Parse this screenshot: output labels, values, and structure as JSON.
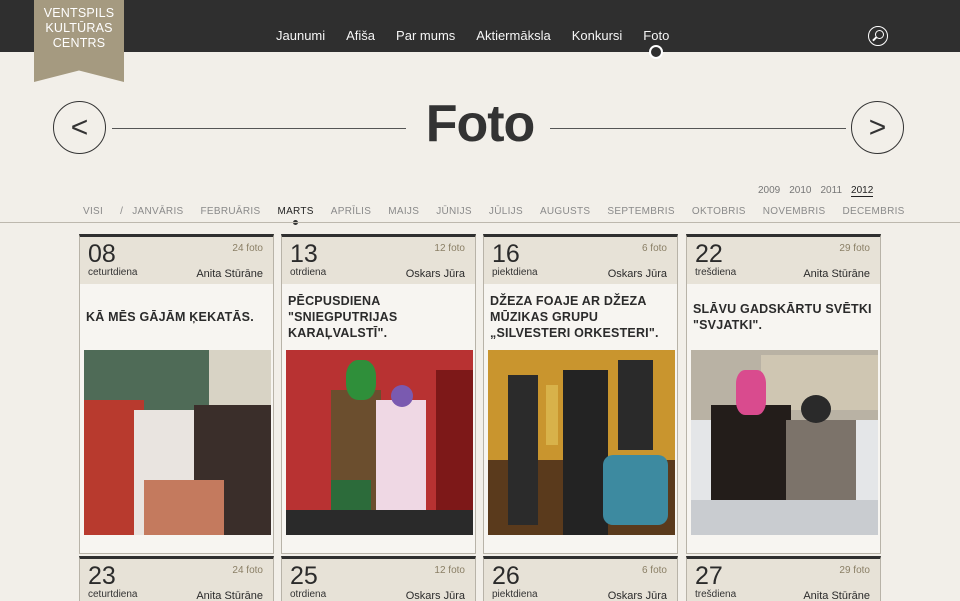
{
  "logo": {
    "line1": "VENTSPILS",
    "line2": "KULTŪRAS",
    "line3": "CENTRS"
  },
  "nav": [
    "Jaunumi",
    "Afiša",
    "Par mums",
    "Aktiermāksla",
    "Konkursi",
    "Foto"
  ],
  "header": {
    "title": "Foto",
    "prev": "<",
    "next": ">"
  },
  "years": [
    "2009",
    "2010",
    "2011",
    "2012"
  ],
  "months": [
    "VISI",
    "/",
    "JANVĀRIS",
    "FEBRUĀRIS",
    "MARTS",
    "APRĪLIS",
    "MAIJS",
    "JŪNIJS",
    "JŪLIJS",
    "AUGUSTS",
    "SEPTEMBRIS",
    "OKTOBRIS",
    "NOVEMBRIS",
    "DECEMBRIS"
  ],
  "cards": [
    {
      "day": "08",
      "weekday": "ceturtdiena",
      "count": "24 foto",
      "author": "Anita Stūrāne",
      "title": "KĀ MĒS GĀJĀM ĶEKATĀS."
    },
    {
      "day": "13",
      "weekday": "otrdiena",
      "count": "12 foto",
      "author": "Oskars Jūra",
      "title": "PĒCPUSDIENA \"SNIEGPUTRIJAS KARAĻVALSTĪ\"."
    },
    {
      "day": "16",
      "weekday": "piektdiena",
      "count": "6 foto",
      "author": "Oskars Jūra",
      "title": "DŽEZA FOAJE AR DŽEZA MŪZIKAS GRUPU „SILVESTERI ORKESTERI\"."
    },
    {
      "day": "22",
      "weekday": "trešdiena",
      "count": "29 foto",
      "author": "Anita Stūrāne",
      "title": "SLĀVU GADSKĀRTU SVĒTKI \"SVJATKI\"."
    },
    {
      "day": "23",
      "weekday": "ceturtdiena",
      "count": "24 foto",
      "author": "Anita Stūrāne"
    },
    {
      "day": "25",
      "weekday": "otrdiena",
      "count": "12 foto",
      "author": "Oskars Jūra"
    },
    {
      "day": "26",
      "weekday": "piektdiena",
      "count": "6 foto",
      "author": "Oskars Jūra"
    },
    {
      "day": "27",
      "weekday": "trešdiena",
      "count": "29 foto",
      "author": "Anita Stūrāne"
    }
  ]
}
